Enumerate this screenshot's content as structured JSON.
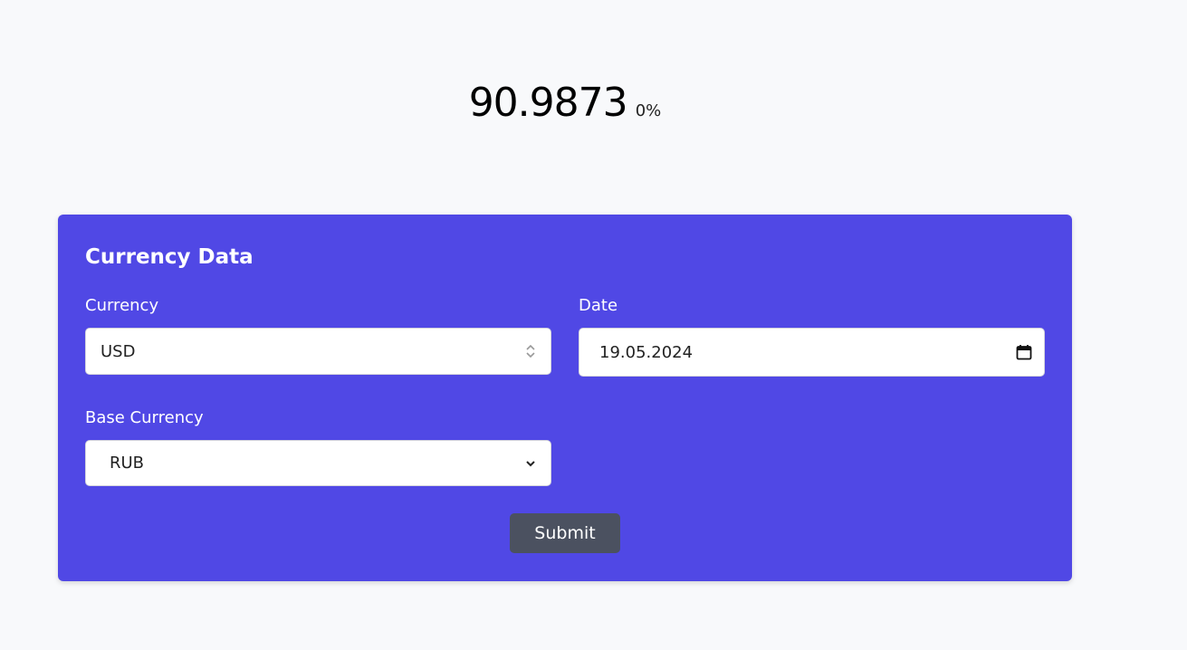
{
  "rate": {
    "value": "90.9873",
    "change": "0%"
  },
  "form": {
    "title": "Currency Data",
    "currency": {
      "label": "Currency",
      "value": "USD"
    },
    "date": {
      "label": "Date",
      "value": "19.05.2024"
    },
    "base_currency": {
      "label": "Base Currency",
      "value": "RUB"
    },
    "submit_label": "Submit"
  },
  "colors": {
    "card_background": "#5048e5",
    "submit_background": "#4b5160",
    "page_background": "#f8f9fb"
  }
}
